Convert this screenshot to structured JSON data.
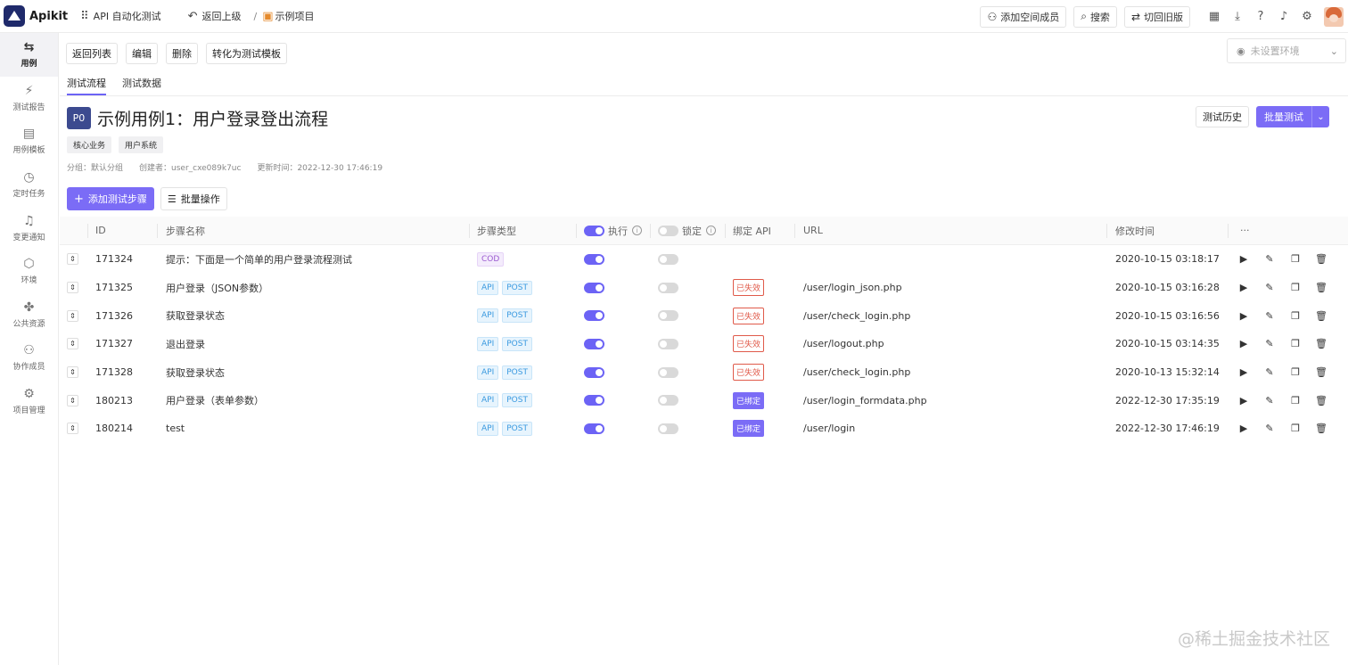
{
  "app": {
    "name": "Apikit"
  },
  "topbar": {
    "project_space": "API 自动化测试",
    "back": "返回上级",
    "separator": "/",
    "project": "示例项目",
    "add_member": "添加空间成员",
    "search": "搜索",
    "old_version": "切回旧版"
  },
  "sidebar": {
    "items": [
      {
        "label": "用例",
        "icon": "test-case-icon",
        "active": true
      },
      {
        "label": "测试报告",
        "icon": "report-icon"
      },
      {
        "label": "用例模板",
        "icon": "template-icon"
      },
      {
        "label": "定时任务",
        "icon": "timer-icon"
      },
      {
        "label": "变更通知",
        "icon": "bell-icon"
      },
      {
        "label": "环境",
        "icon": "environment-icon"
      },
      {
        "label": "公共资源",
        "icon": "puzzle-icon"
      },
      {
        "label": "协作成员",
        "icon": "members-icon"
      },
      {
        "label": "项目管理",
        "icon": "gear-icon"
      }
    ]
  },
  "actions": {
    "back_list": "返回列表",
    "edit": "编辑",
    "delete": "删除",
    "to_template": "转化为测试模板"
  },
  "environment": {
    "placeholder": "未设置环境"
  },
  "tabs": [
    {
      "label": "测试流程",
      "active": true
    },
    {
      "label": "测试数据"
    }
  ],
  "case": {
    "priority": "P0",
    "title": "示例用例1：用户登录登出流程",
    "tags": [
      "核心业务",
      "用户系统"
    ],
    "group": "分组：默认分组",
    "creator": "创建者：user_cxe089k7uc",
    "updated": "更新时间：2022-12-30 17:46:19"
  },
  "buttons": {
    "history": "测试历史",
    "batch_test": "批量测试",
    "add_step": "添加测试步骤",
    "bulk_ops": "批量操作"
  },
  "table": {
    "headers": {
      "id": "ID",
      "name": "步骤名称",
      "type": "步骤类型",
      "exec": "执行",
      "lock": "锁定",
      "bind": "绑定 API",
      "url": "URL",
      "modified": "修改时间",
      "more": "···"
    },
    "rows": [
      {
        "id": "171324",
        "name": "提示：下面是一个简单的用户登录流程测试",
        "types": [
          "COD"
        ],
        "exec": true,
        "lock": false,
        "bind": "",
        "url": "",
        "time": "2020-10-15 03:18:17"
      },
      {
        "id": "171325",
        "name": "用户登录（JSON参数）",
        "types": [
          "API",
          "POST"
        ],
        "exec": true,
        "lock": false,
        "bind": "已失效",
        "url": "/user/login_json.php",
        "time": "2020-10-15 03:16:28"
      },
      {
        "id": "171326",
        "name": "获取登录状态",
        "types": [
          "API",
          "POST"
        ],
        "exec": true,
        "lock": false,
        "bind": "已失效",
        "url": "/user/check_login.php",
        "time": "2020-10-15 03:16:56"
      },
      {
        "id": "171327",
        "name": "退出登录",
        "types": [
          "API",
          "POST"
        ],
        "exec": true,
        "lock": false,
        "bind": "已失效",
        "url": "/user/logout.php",
        "time": "2020-10-15 03:14:35"
      },
      {
        "id": "171328",
        "name": "获取登录状态",
        "types": [
          "API",
          "POST"
        ],
        "exec": true,
        "lock": false,
        "bind": "已失效",
        "url": "/user/check_login.php",
        "time": "2020-10-13 15:32:14"
      },
      {
        "id": "180213",
        "name": "用户登录（表单参数）",
        "types": [
          "API",
          "POST"
        ],
        "exec": true,
        "lock": false,
        "bind": "已绑定",
        "url": "/user/login_formdata.php",
        "time": "2022-12-30 17:35:19"
      },
      {
        "id": "180214",
        "name": "test",
        "types": [
          "API",
          "POST"
        ],
        "exec": true,
        "lock": false,
        "bind": "已绑定",
        "url": "/user/login",
        "time": "2022-12-30 17:46:19"
      }
    ]
  },
  "watermark": "@稀土掘金技术社区",
  "colors": {
    "accent": "#7b6cf6",
    "invalid": "#e05a4a",
    "api_badge": "#3b9ae0",
    "cod_badge": "#9b59d0"
  }
}
